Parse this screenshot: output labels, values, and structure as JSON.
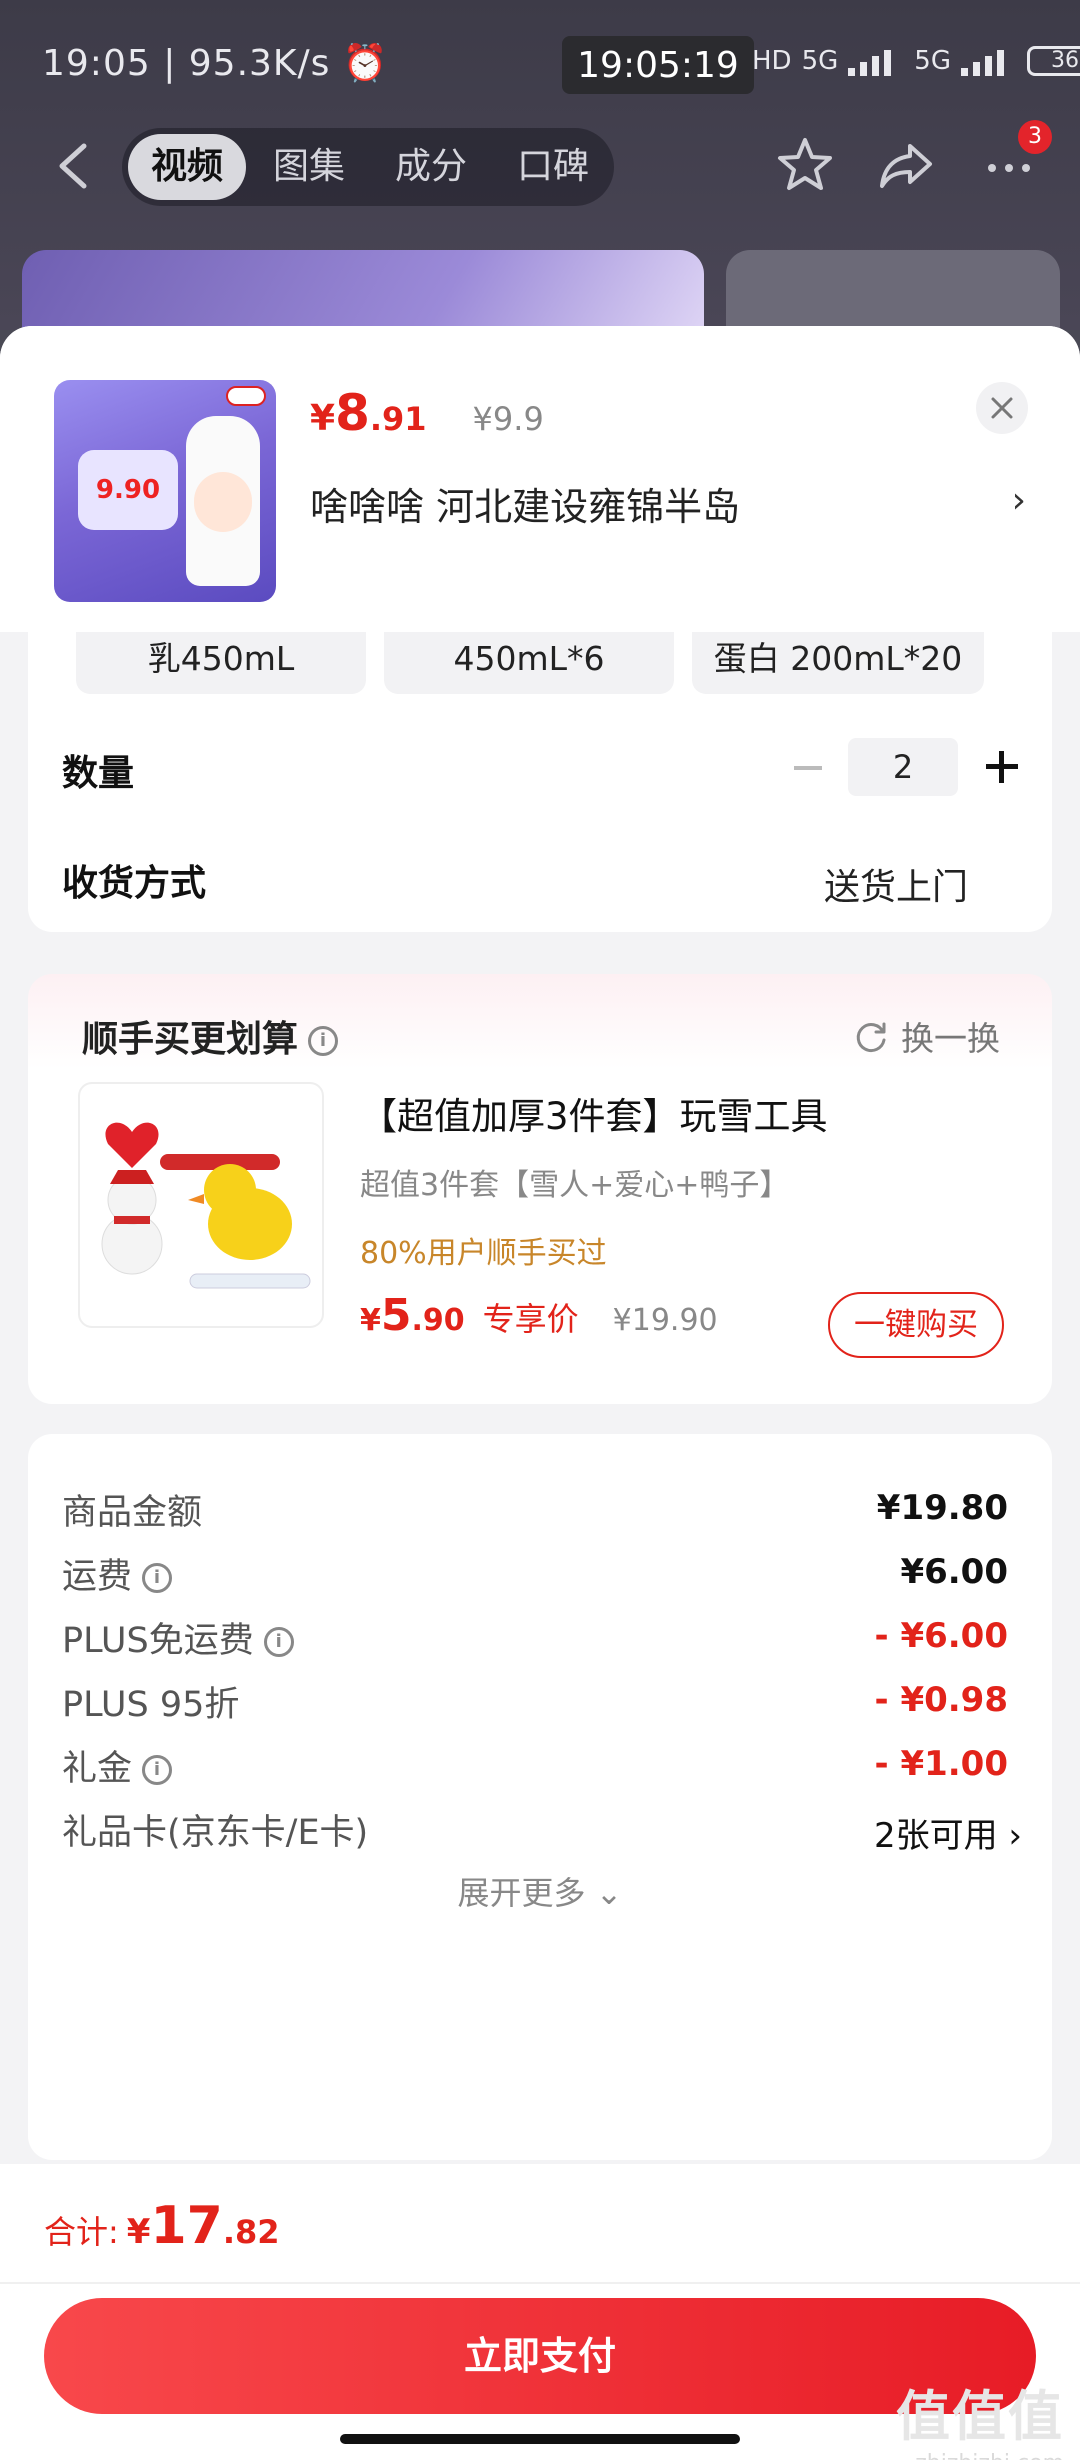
{
  "status_bar": {
    "left": "19:05 | 95.3K/s ⏰",
    "center_time": "19:05:19",
    "right_hd": "HD",
    "right_net1": "5G",
    "right_net2": "5G",
    "battery": "36"
  },
  "top_nav": {
    "tabs": [
      "视频",
      "图集",
      "成分",
      "口碑"
    ],
    "active_tab": 0,
    "more_badge": "3"
  },
  "product": {
    "price_currency": "¥",
    "price_int": "8",
    "price_dec": ".91",
    "original_price": "¥9.9",
    "address": "啥啥啥  河北建设雍锦半岛",
    "thumb_price": "9.90"
  },
  "specs": {
    "chips": [
      "乳450mL",
      "450mL*6",
      "蛋白 200mL*20"
    ]
  },
  "quantity": {
    "label": "数量",
    "value": "2"
  },
  "delivery": {
    "label": "收货方式",
    "value": "送货上门"
  },
  "addon": {
    "title": "顺手买更划算",
    "refresh_label": "换一换",
    "item_title": "【超值加厚3件套】玩雪工具",
    "item_sub": "超值3件套【雪人+爱心+鸭子】",
    "item_hint": "80%用户顺手买过",
    "price_currency": "¥",
    "price_int": "5",
    "price_dec": ".90",
    "exclusive_label": "专享价",
    "original_price": "¥19.90",
    "buy_label": "一键购买"
  },
  "summary": {
    "rows": [
      {
        "label": "商品金额",
        "value": "¥19.80",
        "info": false
      },
      {
        "label": "运费",
        "value": "¥6.00",
        "info": true
      },
      {
        "label": "PLUS免运费",
        "value": "- ¥6.00",
        "info": true
      },
      {
        "label": "PLUS 95折",
        "value": "- ¥0.98",
        "info": false
      },
      {
        "label": "礼金",
        "value": "- ¥1.00",
        "info": true
      },
      {
        "label": "礼品卡(京东卡/E卡)",
        "value": "2张可用 ›",
        "info": false
      }
    ],
    "expand_label": "展开更多 ⌄"
  },
  "footer": {
    "total_label": "合计:",
    "total_currency": "¥",
    "total_int": "17",
    "total_dec": ".82",
    "pay_label": "立即支付"
  },
  "watermark": {
    "top": "值值值",
    "bottom": "zhizhizhi.com"
  },
  "colors": {
    "accent_red": "#e2231a",
    "hint_orange": "#c8862a"
  }
}
